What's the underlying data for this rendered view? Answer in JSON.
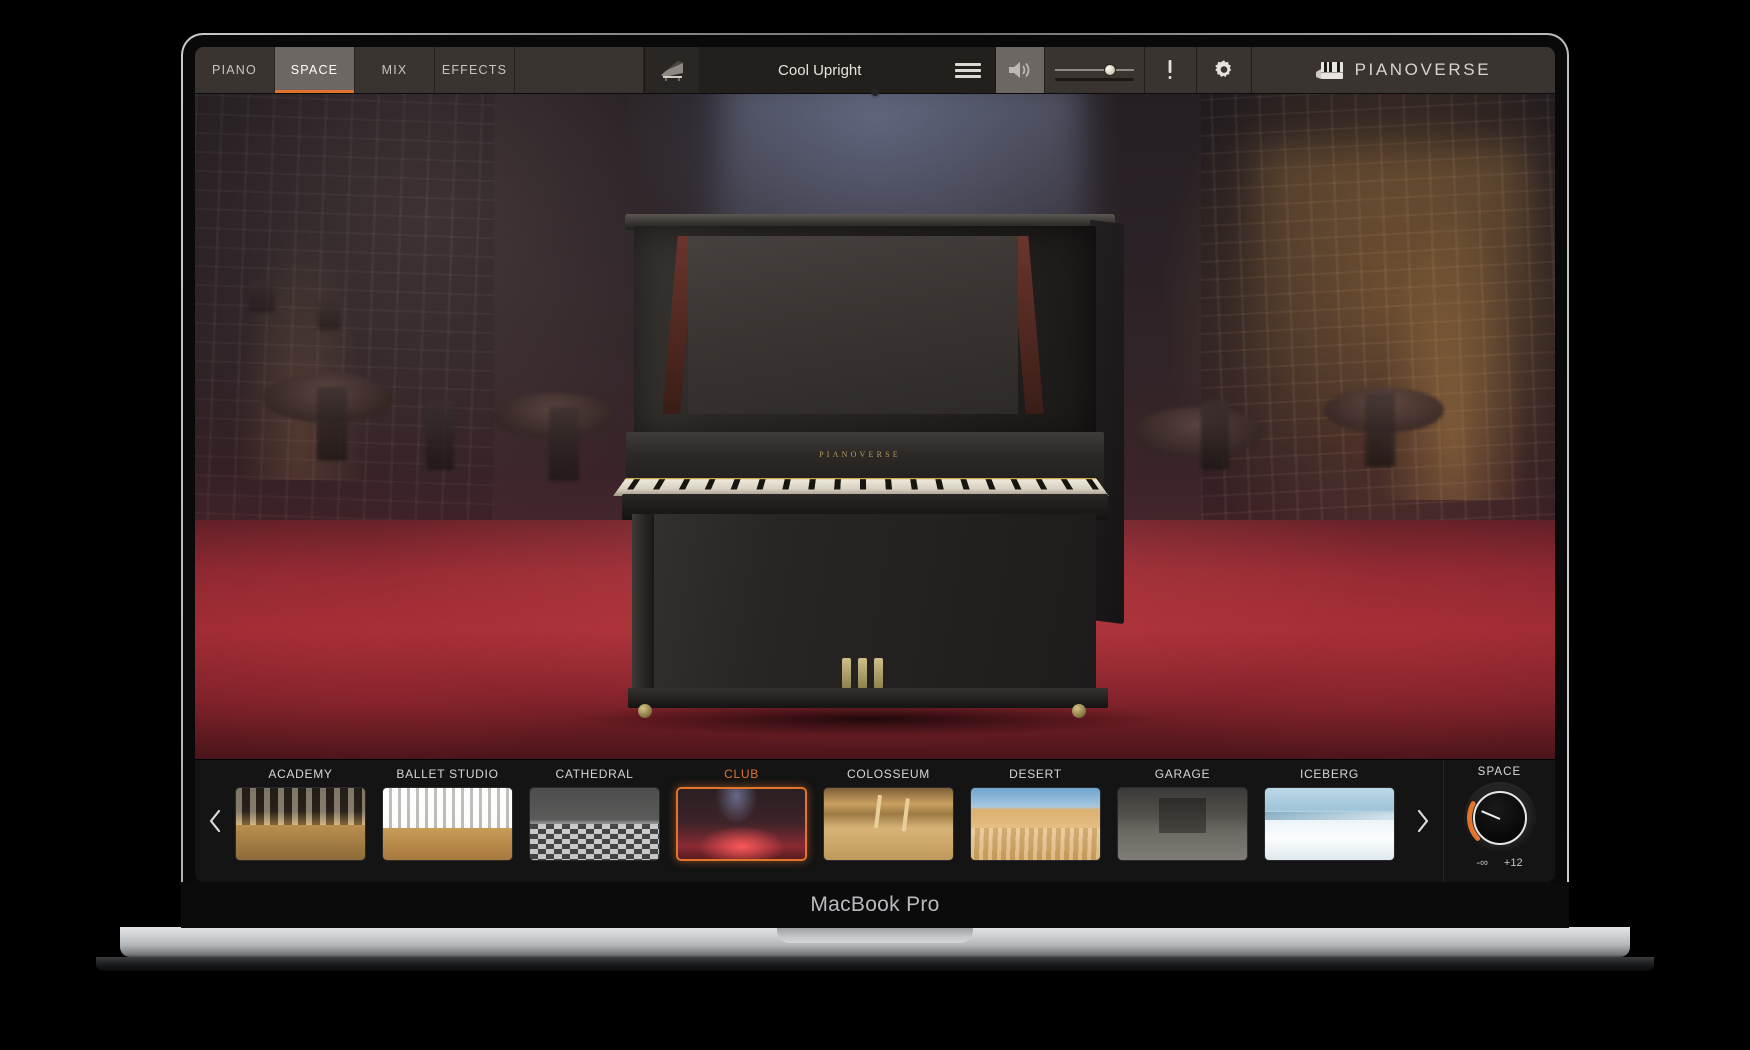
{
  "device": {
    "brand_label": "MacBook Pro"
  },
  "toolbar": {
    "tabs": [
      {
        "label": "PIANO",
        "name": "tab-piano",
        "active": false
      },
      {
        "label": "SPACE",
        "name": "tab-space",
        "active": true
      },
      {
        "label": "MIX",
        "name": "tab-mix",
        "active": false
      },
      {
        "label": "EFFECTS",
        "name": "tab-effects",
        "active": false
      }
    ],
    "preset": {
      "instrument_icon": "grand-piano-icon",
      "name": "Cool Upright",
      "menu_icon": "hamburger-menu-icon"
    },
    "speaker_icon": "speaker-volume-icon",
    "volume": {
      "value_percent": 70,
      "icon": "volume-slider"
    },
    "warning_icon": "exclamation-icon",
    "settings_icon": "gear-icon",
    "logo": {
      "icon": "piano-keys-icon",
      "text": "PIANOVERSE"
    }
  },
  "viewport": {
    "piano_brand": "PIANOVERSE",
    "scene": "club"
  },
  "browser": {
    "prev_icon": "chevron-left-icon",
    "next_icon": "chevron-right-icon",
    "presets": [
      {
        "label": "ACADEMY",
        "thumb": "th-academy",
        "selected": false
      },
      {
        "label": "BALLET STUDIO",
        "thumb": "th-ballet",
        "selected": false
      },
      {
        "label": "CATHEDRAL",
        "thumb": "th-cathedral",
        "selected": false
      },
      {
        "label": "CLUB",
        "thumb": "th-club",
        "selected": true
      },
      {
        "label": "COLOSSEUM",
        "thumb": "th-colosseum",
        "selected": false
      },
      {
        "label": "DESERT",
        "thumb": "th-desert",
        "selected": false
      },
      {
        "label": "GARAGE",
        "thumb": "th-garage",
        "selected": false
      },
      {
        "label": "ICEBERG",
        "thumb": "th-iceberg",
        "selected": false
      }
    ]
  },
  "knob": {
    "title": "SPACE",
    "min_label": "-∞",
    "max_label": "+12",
    "value_percent": 18
  },
  "colors": {
    "accent": "#e2742b",
    "toolbar_bg": "#39342f",
    "tab_active_bg": "#6d6763",
    "browser_bg": "#141414",
    "text": "#d6d6d6"
  }
}
